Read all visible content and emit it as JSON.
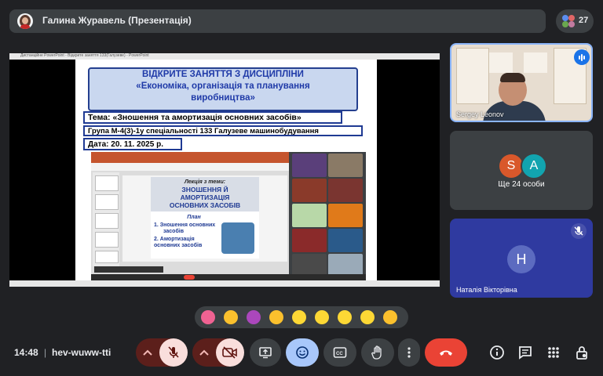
{
  "header": {
    "presenter_label": "Галина Журавель (Презентація)",
    "participants_count": "27"
  },
  "shared_screen": {
    "window_title": "Дистанційне PowerPoint - Відкрите заняття 133(Галузеве) - PowerPoint",
    "slide": {
      "title_line1": "ВІДКРИТЕ ЗАНЯТТЯ З ДИСЦИПЛІНИ",
      "title_line2": "«Економіка, організація та планування",
      "title_line3": "виробництва»",
      "topic": "Тема: «Зношення та амортизація основних засобів»",
      "group": "Група М-4(3)-1у спеціальності 133 Галузеве машинобудування",
      "date": "Дата: 20. 11. 2025 р."
    },
    "nested_slide": {
      "lecture_label": "Лекція з теми:",
      "heading_line1": "ЗНОШЕННЯ Й",
      "heading_line2": "АМОРТИЗАЦІЯ",
      "heading_line3": "ОСНОВНИХ ЗАСОБІВ",
      "plan_label": "План",
      "plan_item1_line1": "1. Зношення основних",
      "plan_item1_line2": "засобів",
      "plan_item2_line1": "2. Амортизація",
      "plan_item2_line2": "основних засобів"
    }
  },
  "participants": {
    "speaker_name": "Sergey Leonov",
    "others_initial_1": "S",
    "others_initial_2": "A",
    "others_label": "Ще 24 особи",
    "third_initial": "H",
    "third_name": "Наталія Вікторівна"
  },
  "bottom_bar": {
    "time": "14:48",
    "separator": "|",
    "meeting_code": "hev-wuww-tti"
  },
  "colors": {
    "background": "#202124",
    "leave": "#ea4335",
    "muted_red": "#5c1f1b",
    "muted_light": "#f9dedc",
    "active_blue": "#a8c7fa",
    "highlight_border": "#8ab4f8"
  },
  "reactions": [
    "sparkling-heart",
    "thumbs-up",
    "party-popper",
    "clapping-hands",
    "laughing-face",
    "surprised-face",
    "crying-face",
    "thinking-face",
    "thumbs-down"
  ]
}
